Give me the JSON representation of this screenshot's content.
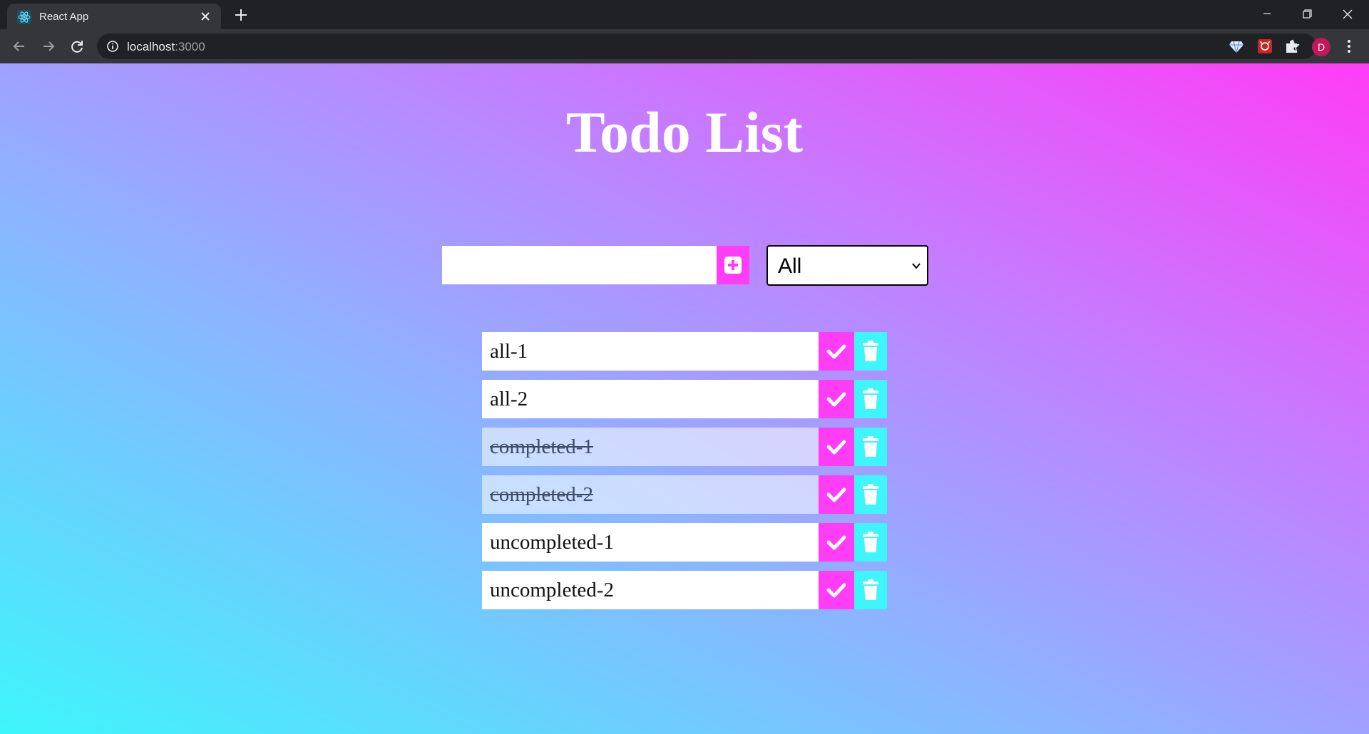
{
  "browser": {
    "tab_title": "React App",
    "url_host": "localhost",
    "url_port": ":3000",
    "profile_initial": "D",
    "icons": {
      "favicon": "react-logo-icon",
      "close_tab": "close-icon",
      "new_tab": "plus-icon",
      "back": "arrow-left-icon",
      "forward": "arrow-right-icon",
      "reload": "reload-icon",
      "site_info": "info-icon",
      "bookmark": "star-icon",
      "extensions": [
        "gem-extension-icon",
        "red-extension-icon",
        "puzzle-icon"
      ],
      "menu": "three-dots-icon"
    }
  },
  "app": {
    "title": "Todo List",
    "input": {
      "value": "",
      "placeholder": ""
    },
    "filter": {
      "selected": "All"
    },
    "colors": {
      "accent_pink": "#ff3cf6",
      "accent_cyan": "#3ef5fb"
    },
    "todos": [
      {
        "text": "all-1",
        "completed": false
      },
      {
        "text": "all-2",
        "completed": false
      },
      {
        "text": "completed-1",
        "completed": true
      },
      {
        "text": "completed-2",
        "completed": true
      },
      {
        "text": "uncompleted-1",
        "completed": false
      },
      {
        "text": "uncompleted-2",
        "completed": false
      }
    ]
  }
}
